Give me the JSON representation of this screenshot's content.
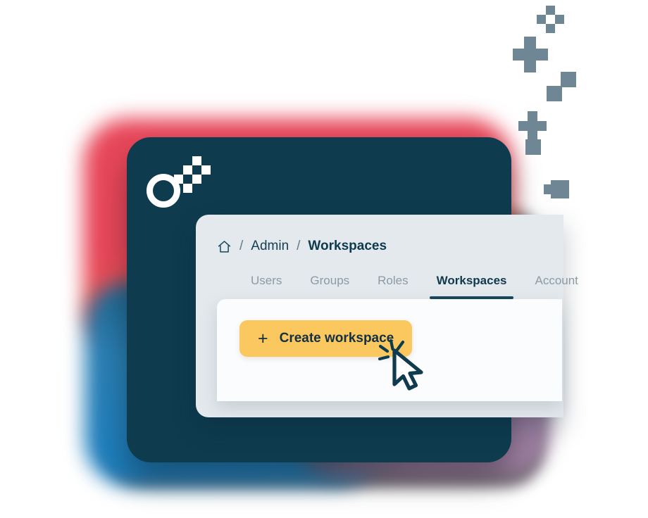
{
  "app": {
    "logo_name": "pixel-ring-logo",
    "card_color": "#0e3b4e",
    "accent_color": "#fbc75f"
  },
  "breadcrumb": {
    "home_icon": "home-icon",
    "separator": "/",
    "items": [
      {
        "label": "Admin",
        "current": false
      },
      {
        "label": "Workspaces",
        "current": true
      }
    ]
  },
  "tabs": {
    "items": [
      {
        "label": "Users",
        "active": false
      },
      {
        "label": "Groups",
        "active": false
      },
      {
        "label": "Roles",
        "active": false
      },
      {
        "label": "Workspaces",
        "active": true
      },
      {
        "label": "Account",
        "active": false
      }
    ]
  },
  "toolbar": {
    "create_plus_icon": "plus-icon",
    "create_label": "Create workspace"
  },
  "cursor": {
    "icon": "mouse-pointer-icon",
    "state": "clicking"
  },
  "decor": {
    "pixel_color": "#6f8795",
    "blob_red": "#e8475a",
    "blob_orange": "#f4a74a",
    "blob_blue": "#1a7fc1",
    "blob_purple": "#a585a8"
  }
}
